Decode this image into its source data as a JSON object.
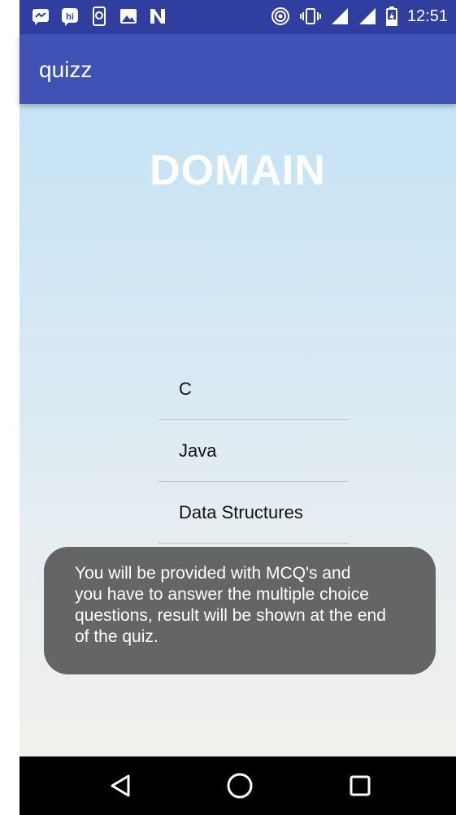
{
  "status_bar": {
    "left_icons": [
      "messenger-icon",
      "hike-icon",
      "phone-sync-icon",
      "gallery-icon",
      "notification-n-icon"
    ],
    "right_icons": [
      "hotspot-icon",
      "vibrate-icon",
      "signal-icon",
      "signal-icon-2",
      "battery-charging-icon"
    ],
    "time": "12:51",
    "color": "#303f9f"
  },
  "app_bar": {
    "title": "quizz",
    "color": "#3f51b5"
  },
  "main": {
    "heading": "DOMAIN",
    "domains": [
      {
        "label": "C"
      },
      {
        "label": "Java"
      },
      {
        "label": "Data Structures"
      }
    ]
  },
  "toast": {
    "lines": [
      "You will be provided with MCQ's and",
      "you have to answer the multiple choice",
      "questions, result will be shown at the end",
      "of the quiz."
    ]
  },
  "nav_bar": {
    "buttons": [
      "back-icon",
      "home-icon",
      "recents-icon"
    ]
  }
}
